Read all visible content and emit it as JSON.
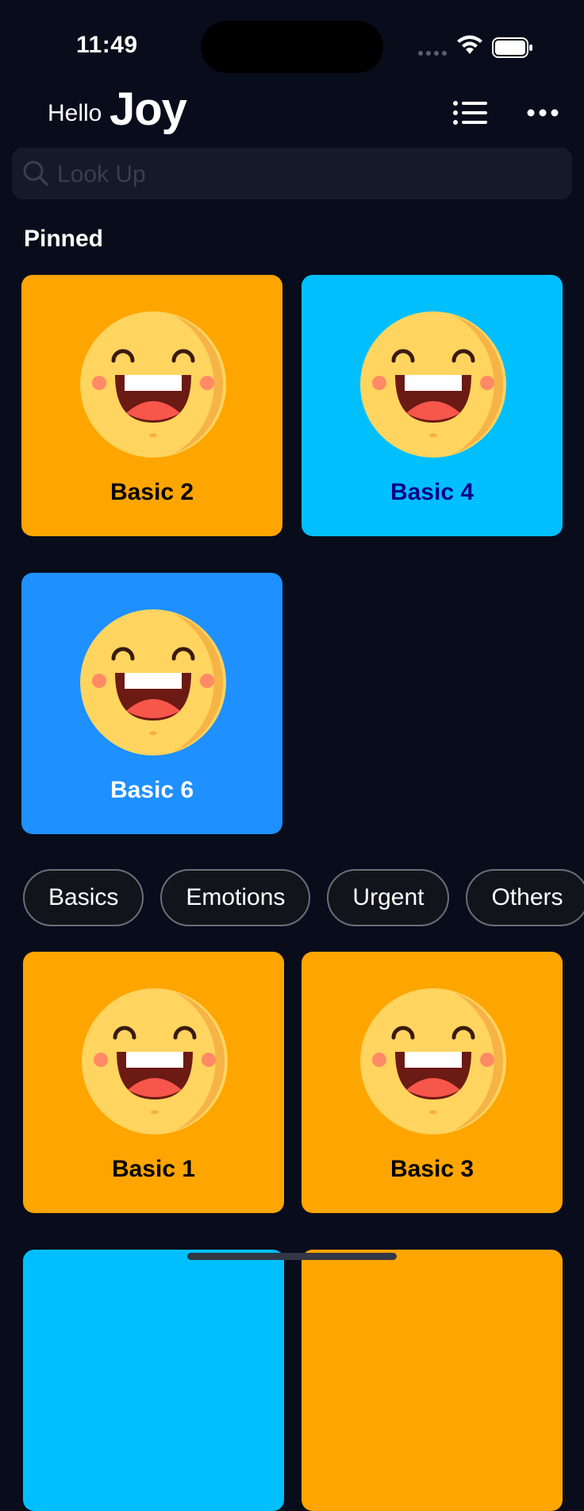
{
  "status_bar": {
    "time": "11:49"
  },
  "header": {
    "greeting": "Hello",
    "name": "Joy"
  },
  "search": {
    "placeholder": "Look Up",
    "value": ""
  },
  "pinned": {
    "title": "Pinned",
    "items": [
      {
        "label": "Basic 2",
        "bg": "#ffa500",
        "text_color": "#000000"
      },
      {
        "label": "Basic 4",
        "bg": "#00bfff",
        "text_color": "#00008b"
      },
      {
        "label": "Basic 6",
        "bg": "#1e90ff",
        "text_color": "#ffffff"
      }
    ]
  },
  "categories": [
    "Basics",
    "Emotions",
    "Urgent",
    "Others"
  ],
  "grid": {
    "items": [
      {
        "label": "Basic 1",
        "bg": "#ffa500",
        "text_color": "#000000"
      },
      {
        "label": "Basic 3",
        "bg": "#ffa500",
        "text_color": "#000000"
      },
      {
        "label": "",
        "bg": "#00bfff",
        "text_color": "#000000"
      },
      {
        "label": "",
        "bg": "#ffa500",
        "text_color": "#000000"
      }
    ]
  },
  "icons": {
    "face": "laughing-face-icon",
    "list": "list-icon",
    "more": "more-icon",
    "search": "search-icon"
  }
}
